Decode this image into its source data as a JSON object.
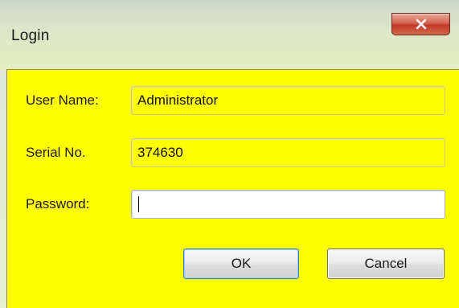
{
  "window": {
    "title": "Login",
    "close_symbol": "x"
  },
  "form": {
    "username": {
      "label": "User Name:",
      "value": "Administrator"
    },
    "serial": {
      "label": "Serial No.",
      "value": "374630"
    },
    "password": {
      "label": "Password:",
      "value": ""
    }
  },
  "buttons": {
    "ok_label": "OK",
    "cancel_label": "Cancel"
  },
  "colors": {
    "client_background": "#ffff00",
    "close_button": "#c0392b",
    "default_button_border": "#3c7fb1"
  },
  "icons": {
    "close": "close-icon"
  }
}
